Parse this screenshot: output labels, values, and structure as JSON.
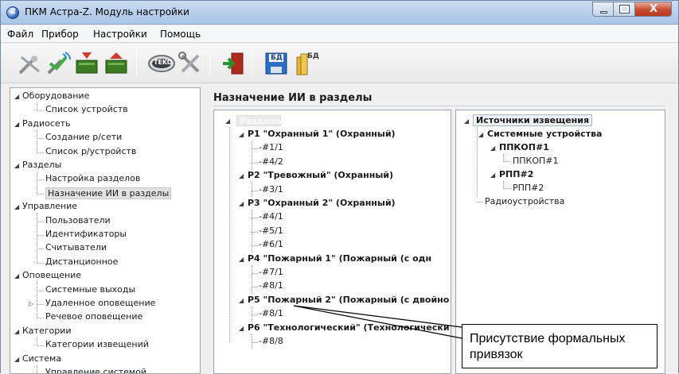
{
  "window": {
    "title": "ПКМ Астра-Z. Модуль настройки",
    "buttons": {
      "minimize": "minimize",
      "maximize": "maximize",
      "close": "X"
    }
  },
  "menu": [
    "Файл",
    "Прибор",
    "Настройки",
    "Помощь"
  ],
  "toolbar": {
    "teko_label": "TEKO",
    "db1_label": "БД",
    "db2_label": "БД",
    "icons": [
      "antenna-off-icon",
      "antenna-wireless-icon",
      "device-read-icon",
      "device-write-icon",
      "teko-icon",
      "tools-icon",
      "exit-icon",
      "db-save-icon",
      "db-open-icon"
    ]
  },
  "nav_tree": [
    {
      "label": "Оборудование",
      "level": 0,
      "expander": "◢"
    },
    {
      "label": "Список устройств",
      "level": 1
    },
    {
      "label": "Радиосеть",
      "level": 0,
      "expander": "◢"
    },
    {
      "label": "Создание р/сети",
      "level": 1
    },
    {
      "label": "Список р/устройств",
      "level": 1
    },
    {
      "label": "Разделы",
      "level": 0,
      "expander": "◢"
    },
    {
      "label": "Настройка разделов",
      "level": 1
    },
    {
      "label": "Назначение ИИ в разделы",
      "level": 1,
      "selected": true
    },
    {
      "label": "Управление",
      "level": 0,
      "expander": "◢"
    },
    {
      "label": "Пользователи",
      "level": 1
    },
    {
      "label": "Идентификаторы",
      "level": 1
    },
    {
      "label": "Считыватели",
      "level": 1
    },
    {
      "label": "Дистанционное",
      "level": 1
    },
    {
      "label": "Оповещение",
      "level": 0,
      "expander": "◢"
    },
    {
      "label": "Системные выходы",
      "level": 1
    },
    {
      "label": "Удаленное оповещение",
      "level": 1,
      "expander": "▷"
    },
    {
      "label": "Речевое оповещение",
      "level": 1
    },
    {
      "label": "Категории",
      "level": 0,
      "expander": "◢"
    },
    {
      "label": "Категории извещений",
      "level": 1
    },
    {
      "label": "Система",
      "level": 0,
      "expander": "◢"
    },
    {
      "label": "Управление системой",
      "level": 1
    }
  ],
  "main": {
    "title": "Назначение ИИ в разделы",
    "sections_root": "Разделы",
    "sections": [
      {
        "label": "P1 \"Охранный 1\" (Охранный)",
        "items": [
          "-#1/1",
          "-#4/2"
        ]
      },
      {
        "label": "P2 \"Тревожный\" (Охранный)",
        "items": [
          "-#3/1"
        ]
      },
      {
        "label": "P3 \"Охранный 2\" (Охранный)",
        "items": [
          "-#4/1",
          "-#5/1",
          "-#6/1"
        ]
      },
      {
        "label": "P4 \"Пожарный 1\" (Пожарный (с одн",
        "items": [
          "-#7/1",
          "-#8/1"
        ]
      },
      {
        "label": "P5 \"Пожарный 2\" (Пожарный (с двойно",
        "items": [
          "-#8/1"
        ]
      },
      {
        "label": "P6 \"Технологический\" (Технологически",
        "items": [
          "-#8/8"
        ]
      }
    ],
    "sources": {
      "root": "Источники извещения",
      "system_devices": "Системные устройства",
      "ppkop": "ППКОП#1",
      "ppkop_child": "ППКОП#1",
      "rpp": "РПП#2",
      "rpp_child": "РПП#2",
      "radio": "Радиоустройства"
    },
    "callout": "Присутствие формальных привязок"
  },
  "colors": {
    "titlebar": "#b7cfee",
    "close_button": "#c74b32",
    "selection": "#e2e2e2"
  }
}
